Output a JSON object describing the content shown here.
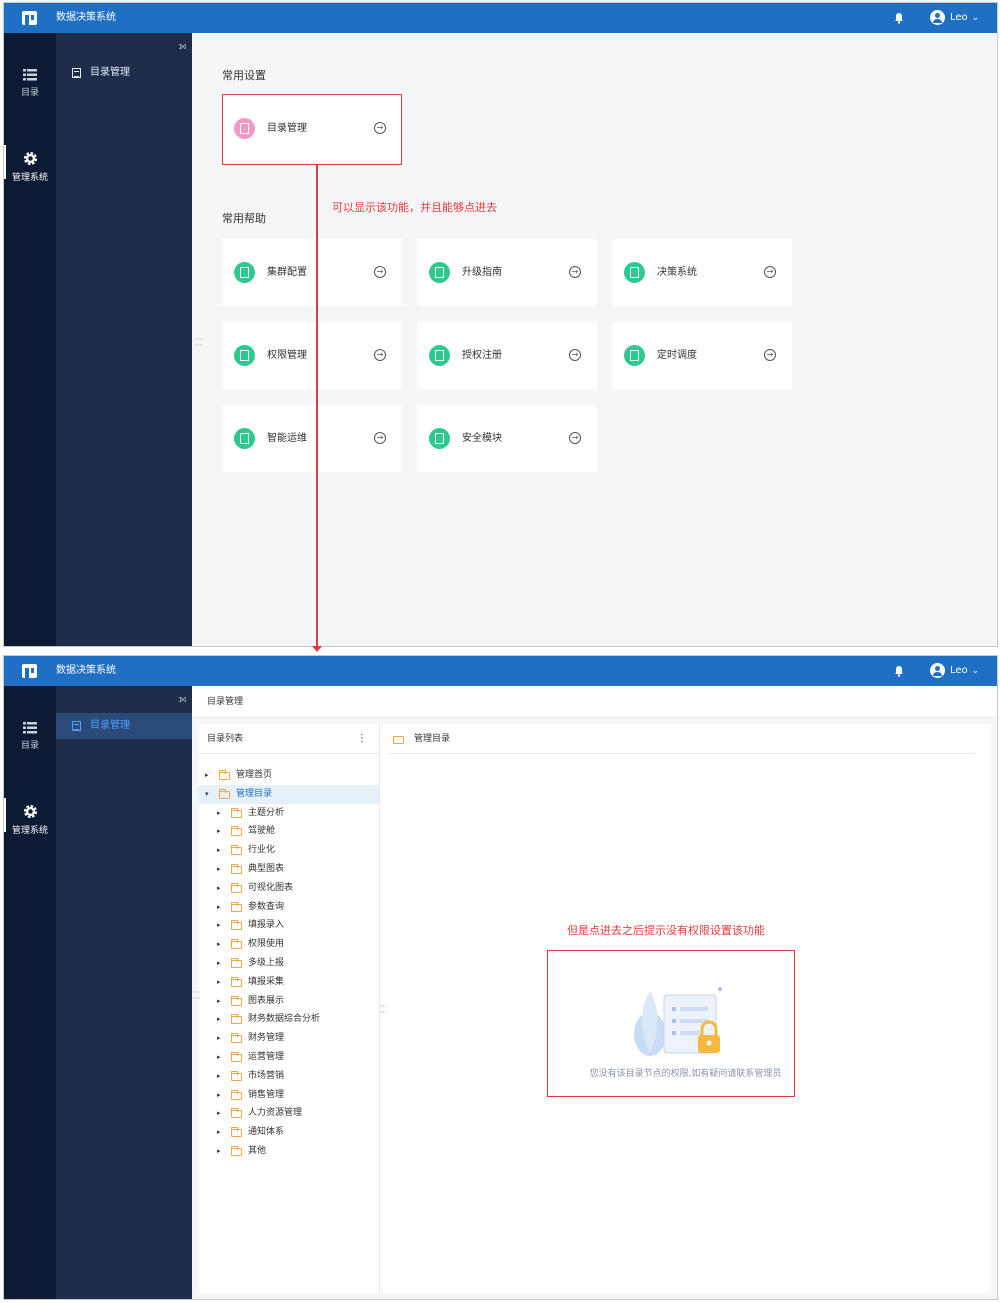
{
  "app": {
    "title": "数据决策系统",
    "user": "Leo"
  },
  "rail": {
    "items": [
      {
        "label": "目录",
        "icon": "list-icon"
      },
      {
        "label": "管理系统",
        "icon": "gear-icon"
      }
    ]
  },
  "shot1": {
    "sidebar_item": "目录管理",
    "section_common_settings": "常用设置",
    "section_common_help": "常用帮助",
    "settings_card": {
      "label": "目录管理",
      "icon": "doc-icon",
      "color": "#f29ac4"
    },
    "help_cards": [
      {
        "label": "集群配置"
      },
      {
        "label": "升级指南"
      },
      {
        "label": "决策系统"
      },
      {
        "label": "权限管理"
      },
      {
        "label": "授权注册"
      },
      {
        "label": "定时调度"
      },
      {
        "label": "智能运维"
      },
      {
        "label": "安全模块"
      }
    ],
    "annotation": "可以显示该功能，并且能够点进去"
  },
  "shot2": {
    "sidebar_item": "目录管理",
    "breadcrumb": "目录管理",
    "left_panel_title": "目录列表",
    "right_panel_title": "管理目录",
    "tree": {
      "root1": "管理首页",
      "root2": "管理目录",
      "children": [
        "主题分析",
        "驾驶舱",
        "行业化",
        "典型图表",
        "可视化图表",
        "参数查询",
        "填报录入",
        "权限使用",
        "多级上报",
        "填报采集",
        "图表展示",
        "财务数据综合分析",
        "财务管理",
        "运营管理",
        "市场营销",
        "销售管理",
        "人力资源管理",
        "通知体系",
        "其他"
      ]
    },
    "annotation": "但是点进去之后提示没有权限设置该功能",
    "empty_message": "您没有该目录节点的权限,如有疑问请联系管理员"
  },
  "colors": {
    "topbar": "#1f6fc5",
    "rail": "#0c1a33",
    "sidebar": "#1e2d4a",
    "accent": "#4ea2ff",
    "annotation": "#e33b3b",
    "card_icon": "#2ec98c"
  }
}
